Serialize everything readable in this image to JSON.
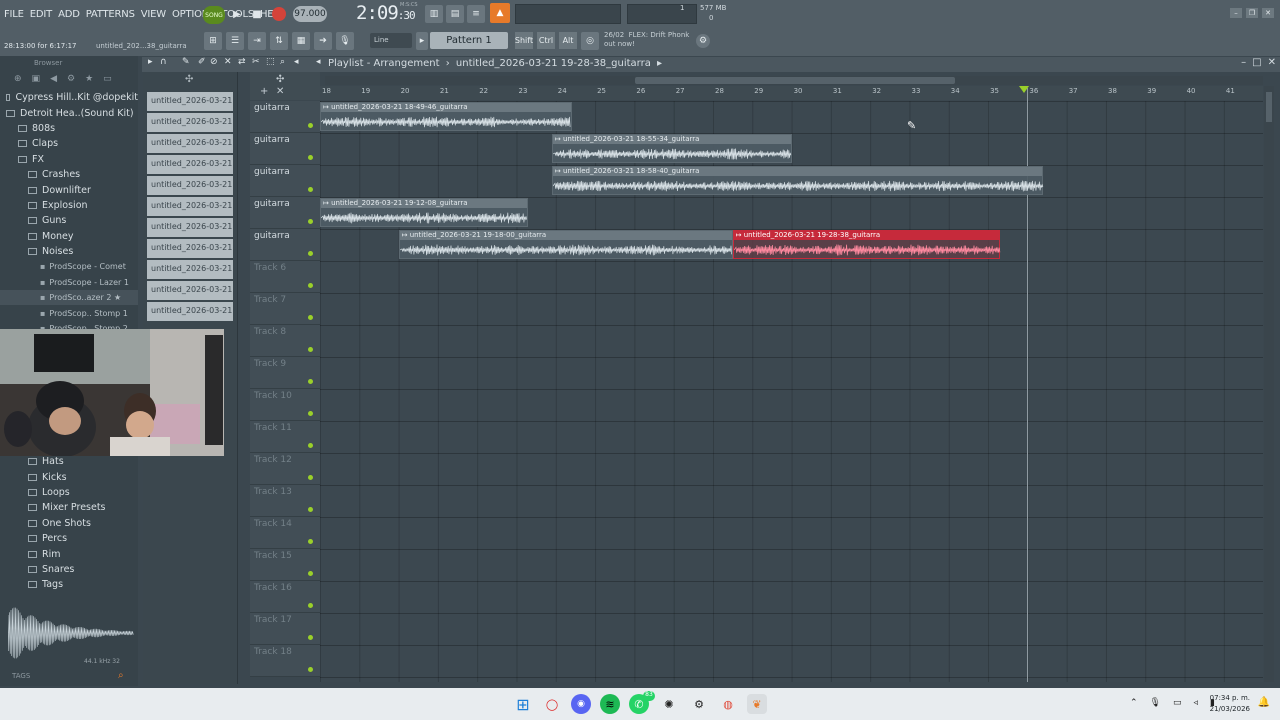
{
  "menu": [
    "FILE",
    "EDIT",
    "ADD",
    "PATTERNS",
    "VIEW",
    "OPTIONS",
    "TOOLS",
    "HELP"
  ],
  "song_mode_label": "SONG",
  "transport": {
    "tempo": "97.000",
    "time_main": "2:09",
    "time_sub": ":30",
    "time_unit": "M:S:CS"
  },
  "memory": {
    "value": "577 MB",
    "line1": "1",
    "line2": "0"
  },
  "hint": {
    "time": "28:13:00 for 6:17:17",
    "project": "untitled_202...38_guitarra"
  },
  "snap_label": "Line",
  "pattern_label": "Pattern 1",
  "modifier_keys": [
    "Shift",
    "Ctrl",
    "Alt"
  ],
  "news": {
    "date": "26/02",
    "text": "FLEX: Drift Phonk",
    "sub": "out now!"
  },
  "browser": {
    "title": "Browser",
    "items": [
      {
        "label": "Cypress Hill..Kit @dopekit",
        "level": 1
      },
      {
        "label": "Detroit Hea..(Sound Kit)",
        "level": 1
      },
      {
        "label": "808s",
        "level": 2
      },
      {
        "label": "Claps",
        "level": 2
      },
      {
        "label": "FX",
        "level": 2
      },
      {
        "label": "Crashes",
        "level": 3
      },
      {
        "label": "Downlifter",
        "level": 3
      },
      {
        "label": "Explosion",
        "level": 3
      },
      {
        "label": "Guns",
        "level": 3
      },
      {
        "label": "Money",
        "level": 3
      },
      {
        "label": "Noises",
        "level": 3
      },
      {
        "label": "ProdScope - Comet",
        "level": 4
      },
      {
        "label": "ProdScope - Lazer 1",
        "level": 4
      },
      {
        "label": "ProdSco..azer 2 ★",
        "level": 4
      },
      {
        "label": "ProdScop.. Stomp 1",
        "level": 4
      },
      {
        "label": "ProdScop.. Stomp 2",
        "level": 4
      }
    ],
    "items_lower": [
      {
        "label": "Hats"
      },
      {
        "label": "Kicks"
      },
      {
        "label": "Loops"
      },
      {
        "label": "Mixer Presets"
      },
      {
        "label": "One Shots"
      },
      {
        "label": "Percs"
      },
      {
        "label": "Rim"
      },
      {
        "label": "Snares"
      },
      {
        "label": "Tags"
      }
    ],
    "sample_info": "44.1 kHz 32",
    "tags_label": "TAGS"
  },
  "picker": [
    "untitled_2026-03-21 18-",
    "untitled_2026-03-21 18-",
    "untitled_2026-03-21 18-",
    "untitled_2026-03-21 18-",
    "untitled_2026-03-21 18-",
    "untitled_2026-03-21 18-",
    "untitled_2026-03-21 18-",
    "untitled_2026-03-21 18-",
    "untitled_2026-03-21 18-",
    "untitled_2026-03-21 19-",
    "untitled_2026-03-21 19-"
  ],
  "playlist": {
    "title": "Playlist - Arrangement",
    "arrangement": "untitled_2026-03-21 19-28-38_guitarra",
    "bars": [
      "18",
      "19",
      "20",
      "21",
      "22",
      "23",
      "24",
      "25",
      "26",
      "27",
      "28",
      "29",
      "30",
      "31",
      "32",
      "33",
      "34",
      "35",
      "36",
      "37",
      "38",
      "39",
      "40",
      "41"
    ],
    "tracks": [
      "guitarra",
      "guitarra",
      "guitarra",
      "guitarra",
      "guitarra",
      "Track 6",
      "Track 7",
      "Track 8",
      "Track 9",
      "Track 10",
      "Track 11",
      "Track 12",
      "Track 13",
      "Track 14",
      "Track 15",
      "Track 16",
      "Track 17",
      "Track 18"
    ],
    "clips": [
      {
        "name": "untitled_2026-03-21 18-49-46_guitarra",
        "track": 0,
        "start": 18.0,
        "end": 24.4,
        "red": false
      },
      {
        "name": "untitled_2026-03-21 18-55-34_guitarra",
        "track": 1,
        "start": 23.9,
        "end": 30.0,
        "red": false
      },
      {
        "name": "untitled_2026-03-21 18-58-40_guitarra",
        "track": 2,
        "start": 23.9,
        "end": 36.4,
        "red": false
      },
      {
        "name": "untitled_2026-03-21 19-12-08_guitarra",
        "track": 3,
        "start": 18.0,
        "end": 23.3,
        "red": false
      },
      {
        "name": "untitled_2026-03-21 19-18-00_guitarra",
        "track": 4,
        "start": 20.0,
        "end": 28.5,
        "red": false
      },
      {
        "name": "untitled_2026-03-21 19-28-38_guitarra",
        "track": 4,
        "start": 28.5,
        "end": 35.3,
        "red": true
      }
    ],
    "playhead_bar": 35.9
  },
  "taskbar": {
    "time": "07:34 p. m.",
    "date": "21/03/2026",
    "whatsapp_badge": "83"
  }
}
